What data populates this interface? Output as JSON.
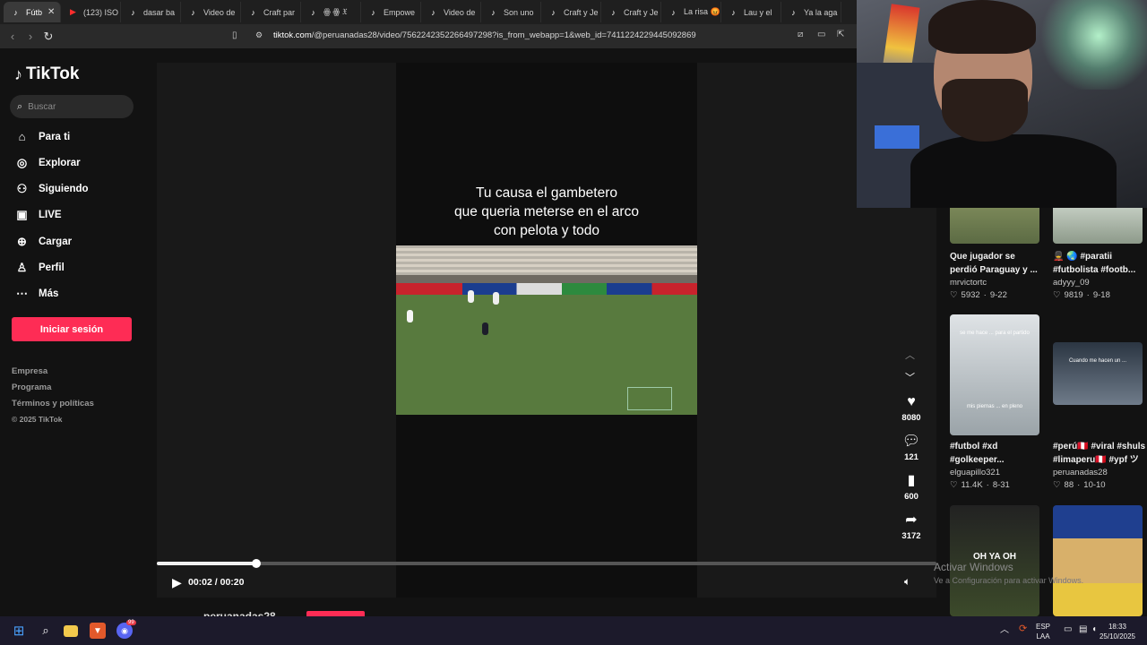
{
  "browser": {
    "tabs": [
      {
        "label": "Fútb",
        "icon": "tiktok-icon",
        "active": true
      },
      {
        "label": "(123) ISO",
        "icon": "youtube-icon"
      },
      {
        "label": "dasar ba",
        "icon": "tiktok-icon"
      },
      {
        "label": "Video de",
        "icon": "tiktok-icon"
      },
      {
        "label": "Craft par",
        "icon": "tiktok-icon"
      },
      {
        "label": "ꙮ ꙮ 𝔛",
        "icon": "tiktok-icon"
      },
      {
        "label": "Empowe",
        "icon": "tiktok-icon"
      },
      {
        "label": "Video de",
        "icon": "tiktok-icon"
      },
      {
        "label": "Son uno",
        "icon": "tiktok-icon"
      },
      {
        "label": "Craft y Je",
        "icon": "tiktok-icon"
      },
      {
        "label": "Craft y Je",
        "icon": "tiktok-icon"
      },
      {
        "label": "La risa 😡",
        "icon": "tiktok-icon"
      },
      {
        "label": "Lau y el",
        "icon": "tiktok-icon"
      },
      {
        "label": "Ya la aga",
        "icon": "tiktok-icon"
      }
    ],
    "url_host": "tiktok.com",
    "url_path": "/@peruanadas28/video/7562242352266497298?is_from_webapp=1&web_id=7411224229445092869"
  },
  "sidebar": {
    "logo": "TikTok",
    "search_placeholder": "Buscar",
    "nav": [
      {
        "label": "Para ti",
        "icon": "home-icon"
      },
      {
        "label": "Explorar",
        "icon": "compass-icon"
      },
      {
        "label": "Siguiendo",
        "icon": "following-icon"
      },
      {
        "label": "LIVE",
        "icon": "live-icon"
      },
      {
        "label": "Cargar",
        "icon": "upload-icon"
      },
      {
        "label": "Perfil",
        "icon": "profile-icon"
      },
      {
        "label": "Más",
        "icon": "more-icon"
      }
    ],
    "login_label": "Iniciar sesión",
    "footer": [
      "Empresa",
      "Programa",
      "Términos y políticas",
      "© 2025 TikTok"
    ]
  },
  "video": {
    "caption": [
      "Tu causa el gambetero",
      "que queria meterse en el arco",
      "con pelota y todo"
    ],
    "time": "00:02 / 00:20",
    "progress_fraction": 0.128,
    "author": "peruanadas28",
    "actions": [
      {
        "name": "like",
        "icon": "heart-icon",
        "count": "8080"
      },
      {
        "name": "comment",
        "icon": "comment-icon",
        "count": "121"
      },
      {
        "name": "save",
        "icon": "bookmark-icon",
        "count": "600"
      },
      {
        "name": "share",
        "icon": "share-icon",
        "count": "3172"
      }
    ]
  },
  "recommendations": [
    {
      "title": "Que jugador se perdió Paraguay y ...",
      "user": "mrvictortc",
      "likes": "5932",
      "date": "9-22"
    },
    {
      "title": "💂 🌏 #paratii #futbolista #footb...",
      "user": "adyyy_09",
      "likes": "9819",
      "date": "9-18"
    },
    {
      "title": "#futbol #xd #golkeeper...",
      "user": "elguapillo321",
      "likes": "11.4K",
      "date": "8-31",
      "overlay": "se me hace ... para el partido",
      "overlay2": "mis piernas ... en pleno"
    },
    {
      "title": "#perú🇵🇪 #viral #shuls #limaperu🇵🇪 #ypf ツ",
      "user": "peruanadas28",
      "likes": "88",
      "date": "10-10",
      "overlay": "Cuando me hacen un ..."
    },
    {
      "title": "",
      "user": "",
      "likes": "",
      "date": "",
      "overlay": "OH YA OH"
    }
  ],
  "windows_watermark": {
    "line1": "Activar Windows",
    "line2": "Ve a Configuración para activar Windows."
  },
  "taskbar": {
    "lang": "ESP",
    "layout": "LAA",
    "clock_time": "18:33",
    "clock_date": "25/10/2025",
    "discord_badge": "99"
  },
  "colors": {
    "accent": "#fe2c55",
    "background": "#121212"
  }
}
